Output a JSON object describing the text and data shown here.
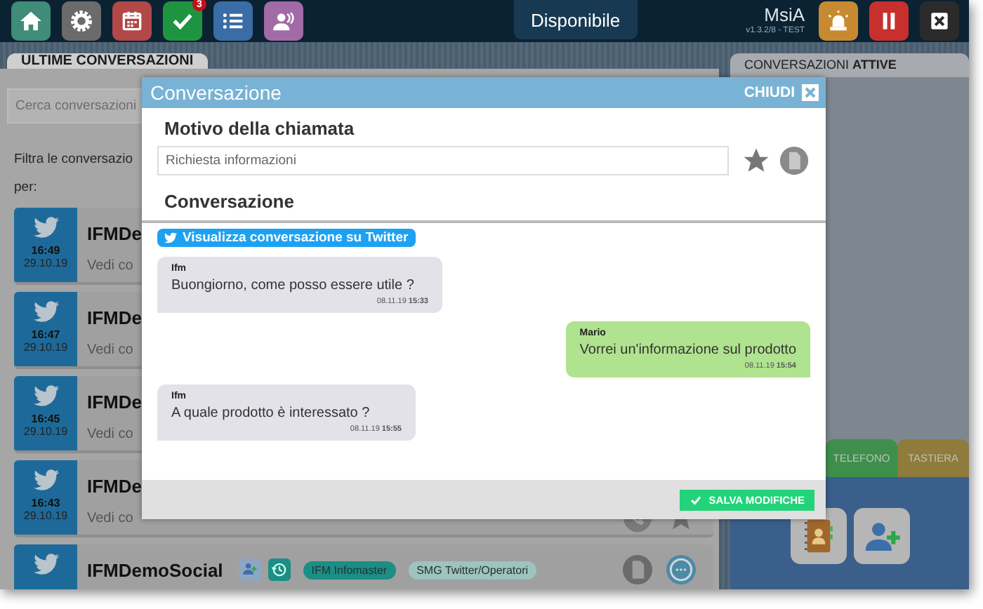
{
  "top_bar": {
    "nav_icons": [
      {
        "kind": "home"
      },
      {
        "kind": "settings"
      },
      {
        "kind": "calendar"
      },
      {
        "kind": "tasks",
        "badge": "3"
      },
      {
        "kind": "list"
      },
      {
        "kind": "contacts"
      }
    ],
    "status": "Disponibile",
    "user": "MsiA",
    "version": "v1.3.2/8 - TEST",
    "action_icons": [
      {
        "kind": "alarm"
      },
      {
        "kind": "pause"
      },
      {
        "kind": "close"
      }
    ]
  },
  "left_panel": {
    "tab": "ULTIME CONVERSAZIONI",
    "search": {
      "placeholder": "Cerca conversazioni"
    },
    "filter_label_lines": [
      "Filtra le conversazio",
      "per:"
    ],
    "conversations": [
      {
        "title": "IFMDe",
        "preview": "Vedi co",
        "time": "16:49",
        "date": "29.10.19"
      },
      {
        "title": "IFMDe",
        "preview": "Vedi co",
        "time": "16:47",
        "date": "29.10.19"
      },
      {
        "title": "IFMDe",
        "preview": "Vedi co",
        "time": "16:45",
        "date": "29.10.19"
      },
      {
        "title": "IFMDe",
        "preview": "Vedi co",
        "time": "16:43",
        "date": "29.10.19",
        "actions": [
          {
            "kind": "call"
          },
          {
            "kind": "favorite"
          }
        ]
      },
      {
        "title": "IFMDemoSocial",
        "icons": [
          {
            "kind": "add-contact"
          },
          {
            "kind": "history"
          }
        ],
        "tags": [
          {
            "label": "IFM Infomaster",
            "color": "#1b8e85"
          },
          {
            "label": "SMG Twitter/Operatori",
            "color": "#9fc3bf"
          }
        ],
        "actions": [
          {
            "kind": "note"
          },
          {
            "kind": "chat"
          }
        ]
      }
    ]
  },
  "right_panel": {
    "tab": "CONVERSAZIONI **ATTIVE**",
    "bottom_tabs": [
      {
        "label": "TELEFONO",
        "color": "#3e8f4c"
      },
      {
        "label": "TASTIERA",
        "color": "#8f7b3b"
      }
    ],
    "buttons": [
      {
        "kind": "address-book"
      },
      {
        "kind": "add-contact"
      }
    ]
  },
  "modal": {
    "title": "Conversazione",
    "close_label": "CHIUDI",
    "reason_label": "Motivo della chiamata",
    "reason_value": "Richiesta informazioni",
    "conversation_label": "Conversazione",
    "twitter_button": "Visualizza conversazione su Twitter",
    "messages": [
      {
        "kind": "incoming",
        "sender": "Ifm",
        "text": "Buongiorno, come posso essere utile ?",
        "time": "08.11.19 **15:33**"
      },
      {
        "kind": "outgoing",
        "sender": "Mario",
        "text": "Vorrei un'informazione sul prodotto",
        "time": "08.11.19 **15:54**"
      },
      {
        "kind": "incoming",
        "sender": "Ifm",
        "text": "A quale prodotto è interessato ?",
        "time": "08.11.19 **15:55**"
      }
    ],
    "save_button": "SALVA MODIFICHE"
  }
}
